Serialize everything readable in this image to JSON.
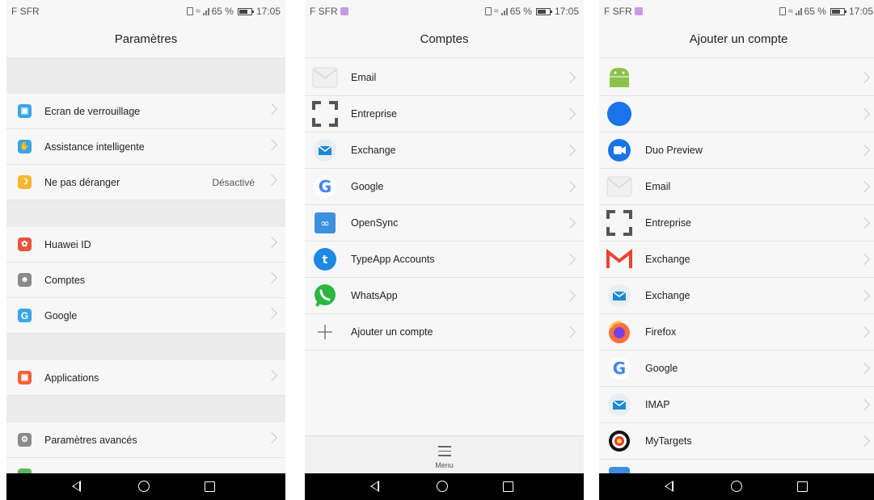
{
  "status": {
    "carrier": "F SFR",
    "battery": "65 %",
    "time": "17:05"
  },
  "screen1": {
    "title": "Paramètres",
    "items": [
      {
        "label": "Ecran de verrouillage",
        "icon": "lock-screen-icon",
        "color": "#3aa5e8"
      },
      {
        "label": "Assistance intelligente",
        "icon": "hand-icon",
        "color": "#3aa5e8"
      },
      {
        "label": "Ne pas déranger",
        "icon": "moon-icon",
        "color": "#f5b82e",
        "value": "Désactivé"
      },
      {
        "label": "Huawei ID",
        "icon": "huawei-icon",
        "color": "#e8553e"
      },
      {
        "label": "Comptes",
        "icon": "account-icon",
        "color": "#8a8a8a"
      },
      {
        "label": "Google",
        "icon": "google-icon",
        "color": "#3aa5e8"
      },
      {
        "label": "Applications",
        "icon": "apps-icon",
        "color": "#f4623a"
      },
      {
        "label": "Paramètres avancés",
        "icon": "gear-icon",
        "color": "#8a8a8a"
      }
    ]
  },
  "screen2": {
    "title": "Comptes",
    "items": [
      {
        "label": "Email",
        "icon": "email-icon"
      },
      {
        "label": "Entreprise",
        "icon": "enterprise-icon"
      },
      {
        "label": "Exchange",
        "icon": "exchange-icon"
      },
      {
        "label": "Google",
        "icon": "google-icon"
      },
      {
        "label": "OpenSync",
        "icon": "opensync-icon"
      },
      {
        "label": "TypeApp Accounts",
        "icon": "typeapp-icon"
      },
      {
        "label": "WhatsApp",
        "icon": "whatsapp-icon"
      },
      {
        "label": "Ajouter un compte",
        "icon": "plus-icon"
      }
    ],
    "menu_label": "Menu"
  },
  "screen3": {
    "title": "Ajouter un compte",
    "items": [
      {
        "label": "",
        "icon": "android-icon"
      },
      {
        "label": "",
        "icon": "blue-circle-icon"
      },
      {
        "label": "Duo Preview",
        "icon": "duo-icon"
      },
      {
        "label": "Email",
        "icon": "email-icon"
      },
      {
        "label": "Entreprise",
        "icon": "enterprise-icon"
      },
      {
        "label": "Exchange",
        "icon": "gmail-icon"
      },
      {
        "label": "Exchange",
        "icon": "exchange-icon"
      },
      {
        "label": "Firefox",
        "icon": "firefox-icon"
      },
      {
        "label": "Google",
        "icon": "google-icon"
      },
      {
        "label": "IMAP",
        "icon": "imap-icon"
      },
      {
        "label": "MyTargets",
        "icon": "mytargets-icon"
      }
    ]
  }
}
